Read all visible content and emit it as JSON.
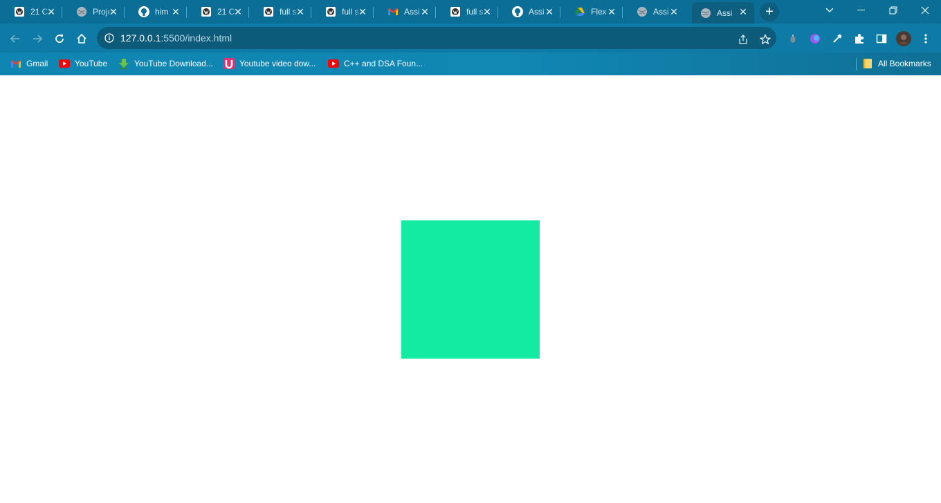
{
  "tabs": [
    {
      "title": "21 C",
      "icon": "site-icon"
    },
    {
      "title": "Proje",
      "icon": "globe-icon"
    },
    {
      "title": "him",
      "icon": "github-icon"
    },
    {
      "title": "21 C",
      "icon": "site-icon"
    },
    {
      "title": "full s",
      "icon": "site-icon"
    },
    {
      "title": "full s",
      "icon": "site-icon"
    },
    {
      "title": "Assi",
      "icon": "gmail-icon"
    },
    {
      "title": "full s",
      "icon": "site-icon"
    },
    {
      "title": "Assi",
      "icon": "github-icon"
    },
    {
      "title": "Flex",
      "icon": "drive-icon"
    },
    {
      "title": "Assi",
      "icon": "globe-icon"
    },
    {
      "title": "Assi",
      "icon": "globe-icon",
      "active": true
    }
  ],
  "omnibox": {
    "host": "127.0.0.1",
    "path": ":5500/index.html"
  },
  "bookmarks": [
    {
      "label": "Gmail",
      "icon": "gmail-icon"
    },
    {
      "label": "YouTube",
      "icon": "youtube-icon"
    },
    {
      "label": "YouTube Download...",
      "icon": "download-icon"
    },
    {
      "label": "Youtube video dow...",
      "icon": "u-icon"
    },
    {
      "label": "C++ and DSA Foun...",
      "icon": "youtube-icon"
    }
  ],
  "all_bookmarks": "All Bookmarks",
  "colors": {
    "tabstrip": "#0b6e96",
    "toolbar": "#0e7aa6",
    "box": "#13eba2"
  }
}
